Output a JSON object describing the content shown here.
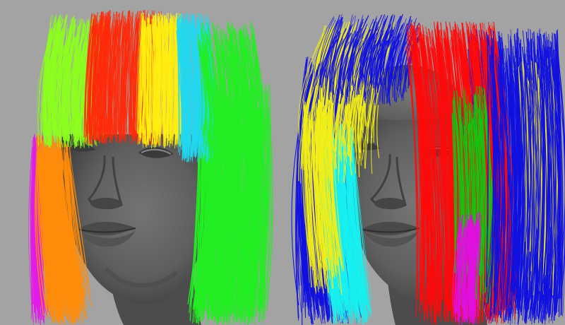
{
  "viewport": {
    "background": "#a3a3a3",
    "skin_color": "#5c5c5c",
    "skin_shadow": "#3e3e3e",
    "skin_highlight": "#7a7a7a"
  },
  "models": [
    {
      "id": "left",
      "hair_groups": [
        {
          "name": "magenta",
          "color": "#e21de6"
        },
        {
          "name": "orange",
          "color": "#ff8c0a"
        },
        {
          "name": "lime",
          "color": "#8cff1e"
        },
        {
          "name": "red",
          "color": "#ff2a0a"
        },
        {
          "name": "yellow",
          "color": "#ffee10"
        },
        {
          "name": "cyan",
          "color": "#22d8f0"
        },
        {
          "name": "green",
          "color": "#22ee22"
        }
      ]
    },
    {
      "id": "right",
      "hair_groups": [
        {
          "name": "blue",
          "color": "#1010e0"
        },
        {
          "name": "yellow",
          "color": "#f2ee18"
        },
        {
          "name": "cyan",
          "color": "#18f0f0"
        },
        {
          "name": "red",
          "color": "#ff0a0a"
        },
        {
          "name": "green",
          "color": "#10c810"
        },
        {
          "name": "magenta",
          "color": "#e010e0"
        }
      ]
    }
  ]
}
